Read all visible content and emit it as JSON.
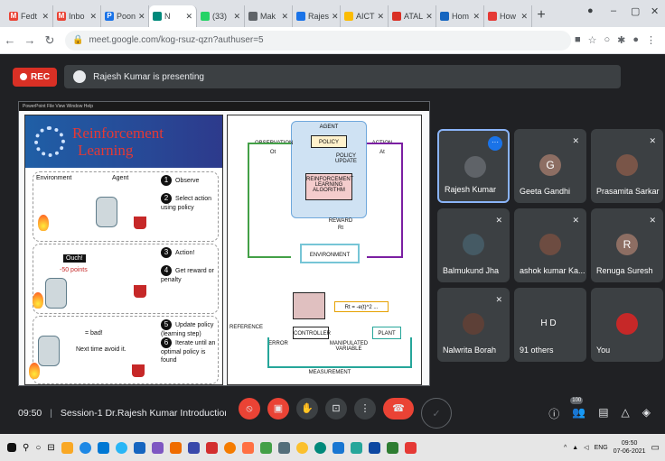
{
  "browser": {
    "tabs": [
      {
        "label": "Fedt",
        "fav": "M",
        "color": "#ea4335"
      },
      {
        "label": "Inbo",
        "fav": "M",
        "color": "#ea4335"
      },
      {
        "label": "Poon",
        "fav": "P",
        "color": "#1a73e8"
      },
      {
        "label": "N",
        "fav": "",
        "color": "#00897b",
        "active": true
      },
      {
        "label": "(33)",
        "fav": "",
        "color": "#25d366"
      },
      {
        "label": "Mak",
        "fav": "",
        "color": "#5f6368"
      },
      {
        "label": "Rajes",
        "fav": "",
        "color": "#1a73e8"
      },
      {
        "label": "AICT",
        "fav": "",
        "color": "#fbbc04"
      },
      {
        "label": "ATAL",
        "fav": "",
        "color": "#d93025"
      },
      {
        "label": "Hom",
        "fav": "",
        "color": "#1565c0"
      },
      {
        "label": "How",
        "fav": "",
        "color": "#e53935"
      }
    ],
    "new_tab": "+",
    "url": "meet.google.com/kog-rsuz-qzn?authuser=5"
  },
  "meet": {
    "rec_label": "REC",
    "presenting_text": "Rajesh Kumar is presenting",
    "meeting_time": "09:50",
    "meeting_title": "Session-1 Dr.Rajesh Kumar Introduction to ...",
    "raised_count": "100"
  },
  "slide": {
    "title_line1": "Reinforcement",
    "title_line2": "Learning",
    "environment": "Environment",
    "agent": "Agent",
    "steps": [
      {
        "n": "1",
        "text": "Observe"
      },
      {
        "n": "2",
        "text": "Select action using policy"
      },
      {
        "n": "3",
        "text": "Action!"
      },
      {
        "n": "4",
        "text": "Get reward or penalty"
      },
      {
        "n": "5",
        "text": "Update policy (learning step)"
      },
      {
        "n": "6",
        "text": "Iterate until an optimal policy is found"
      }
    ],
    "ouch": "Ouch!",
    "penalty": "-50 points",
    "bad": "= bad!",
    "next_time": "Next time avoid it.",
    "diagram": {
      "agent": "AGENT",
      "policy": "POLICY",
      "policy_update": "POLICY UPDATE",
      "rl_algo": "REINFORCEMENT LEARNING ALGORITHM",
      "observation": "OBSERVATION",
      "obs_sym": "Ot",
      "action": "ACTION",
      "action_sym": "At",
      "reward": "REWARD",
      "reward_sym": "Rt",
      "environment": "ENVIRONMENT",
      "formula": "Rt = -e(t)^2 ...",
      "reference": "REFERENCE",
      "error": "ERROR",
      "controller": "CONTROLLER",
      "manipulated": "MANIPULATED VARIABLE",
      "plant": "PLANT",
      "measurement": "MEASUREMENT"
    }
  },
  "participants": [
    {
      "name": "Rajesh Kumar",
      "initial": "",
      "color": "#5f6368",
      "active": true
    },
    {
      "name": "Geeta Gandhi",
      "initial": "G",
      "color": "#8d6e63"
    },
    {
      "name": "Prasamita Sarkar",
      "initial": "",
      "color": "#795548"
    },
    {
      "name": "Balmukund Jha",
      "initial": "",
      "color": "#455a64"
    },
    {
      "name": "ashok kumar Ka...",
      "initial": "",
      "color": "#6d4c41"
    },
    {
      "name": "Renuga Suresh",
      "initial": "R",
      "color": "#8d6e63"
    },
    {
      "name": "Nalwrita Borah",
      "initial": "",
      "color": "#5d4037"
    },
    {
      "name": "91 others",
      "initial": "H D",
      "color": "#3c4043"
    },
    {
      "name": "You",
      "initial": "",
      "color": "#c62828"
    }
  ],
  "taskbar": {
    "lang": "ENG",
    "time": "09:50",
    "date": "07-06-2021"
  }
}
